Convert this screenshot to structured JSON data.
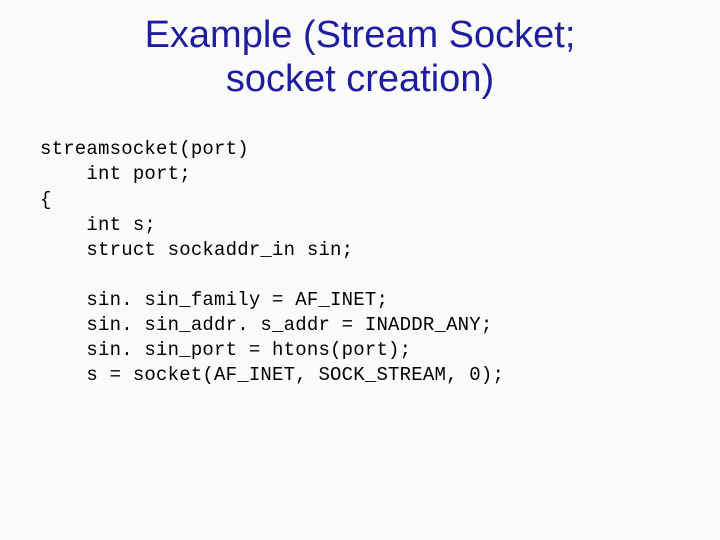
{
  "title_line1": "Example (Stream Socket;",
  "title_line2": "socket creation)",
  "code": {
    "l1": "streamsocket(port)",
    "l2": "    int port;",
    "l3": "{",
    "l4": "    int s;",
    "l5": "    struct sockaddr_in sin;",
    "l6": "",
    "l7": "    sin. sin_family = AF_INET;",
    "l8": "    sin. sin_addr. s_addr = INADDR_ANY;",
    "l9": "    sin. sin_port = htons(port);",
    "l10": "    s = socket(AF_INET, SOCK_STREAM, 0);"
  }
}
